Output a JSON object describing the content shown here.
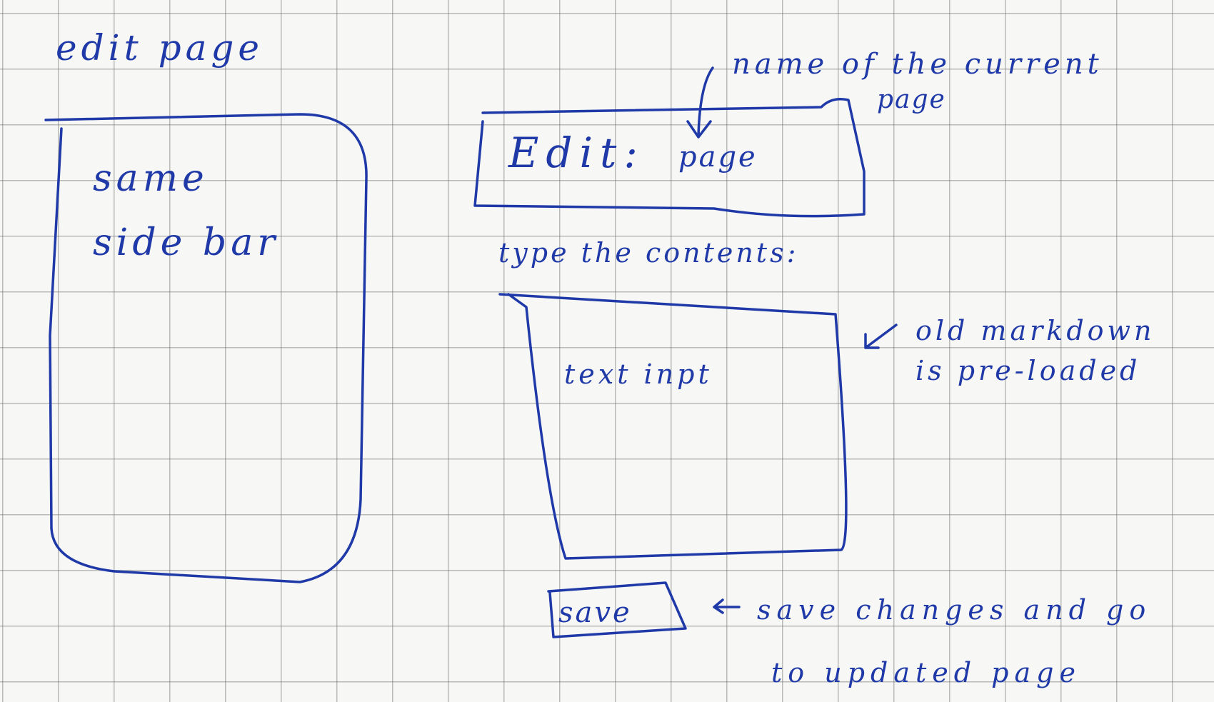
{
  "heading": {
    "text": "edit page"
  },
  "sidebar": {
    "line1": "same",
    "line2": "side bar"
  },
  "header_box": {
    "label": "Edit:",
    "page_name": "page"
  },
  "annotations": {
    "page_name_line1": "name of the current",
    "page_name_line2": "page",
    "editor_line1": "old markdown",
    "editor_line2": "is pre-loaded",
    "save_line1": "save changes and go",
    "save_line2": "to updated page"
  },
  "editor": {
    "prompt": "type the contents:",
    "placeholder": "text inpt"
  },
  "save_button": {
    "label": "save"
  },
  "colors": {
    "ink": "#1f3aa8",
    "grid": "#8a8a8a",
    "paper": "#f7f7f5"
  }
}
